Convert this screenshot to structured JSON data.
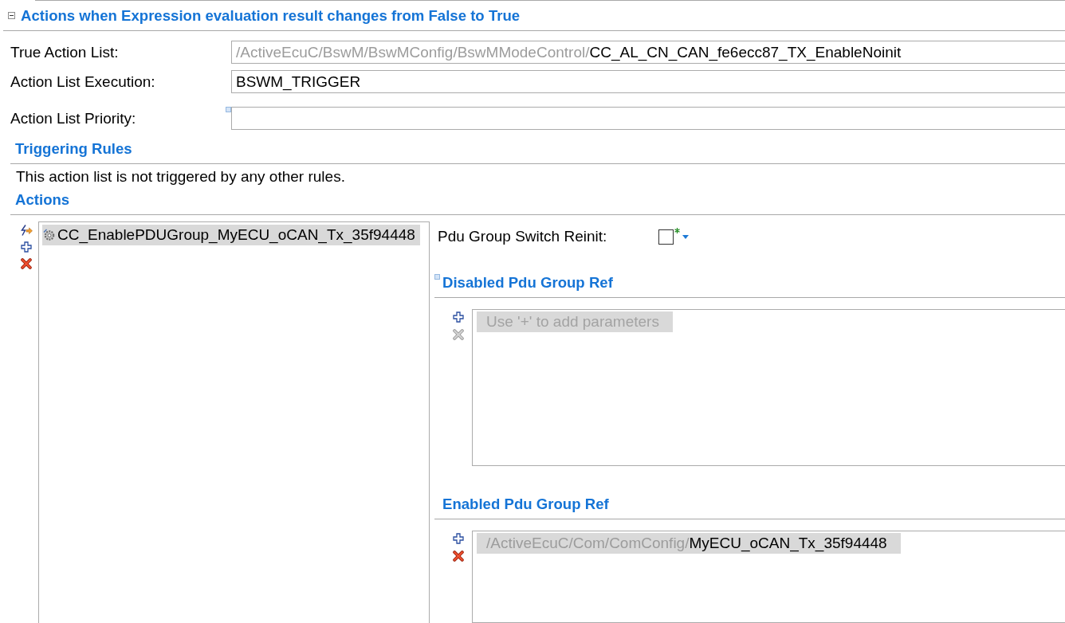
{
  "section": {
    "title": "Actions when Expression evaluation result changes from False to True",
    "expanded": true
  },
  "fields": [
    {
      "label": "True Action List:",
      "path": "/ActiveEcuC/BswM/BswMConfig/BswMModeControl/",
      "value": "CC_AL_CN_CAN_fe6ecc87_TX_EnableNoinit",
      "marker": false
    },
    {
      "label": "Action List Execution:",
      "value": "BSWM_TRIGGER",
      "marker": false
    },
    {
      "label": "Action List Priority:",
      "marker": true
    }
  ],
  "triggering_rules": {
    "title": "Triggering Rules",
    "text": "This action list is not triggered by any other rules."
  },
  "actions": {
    "title": "Actions",
    "buttons": [
      {
        "kind": "wizard",
        "disabled": false
      },
      {
        "kind": "add",
        "disabled": false
      },
      {
        "kind": "delete",
        "disabled": false
      }
    ],
    "items": [
      {
        "label": "CC_EnablePDUGroup_MyECU_oCAN_Tx_35f94448",
        "selected": true
      }
    ]
  },
  "details": {
    "reinit": {
      "label": "Pdu Group Switch Reinit:",
      "checked": false
    },
    "references": [
      {
        "title": "Disabled Pdu Group Ref",
        "marker": true,
        "buttons": [
          {
            "kind": "add",
            "disabled": false
          },
          {
            "kind": "delete",
            "disabled": true
          }
        ],
        "placeholder": "Use '+' to add parameters"
      },
      {
        "title": "Enabled Pdu Group Ref",
        "marker": false,
        "buttons": [
          {
            "kind": "add",
            "disabled": false
          },
          {
            "kind": "delete",
            "disabled": false
          }
        ],
        "items": [
          {
            "path": "/ActiveEcuC/Com/ComConfig/",
            "value": "MyECU_oCAN_Tx_35f94448"
          }
        ]
      }
    ]
  }
}
